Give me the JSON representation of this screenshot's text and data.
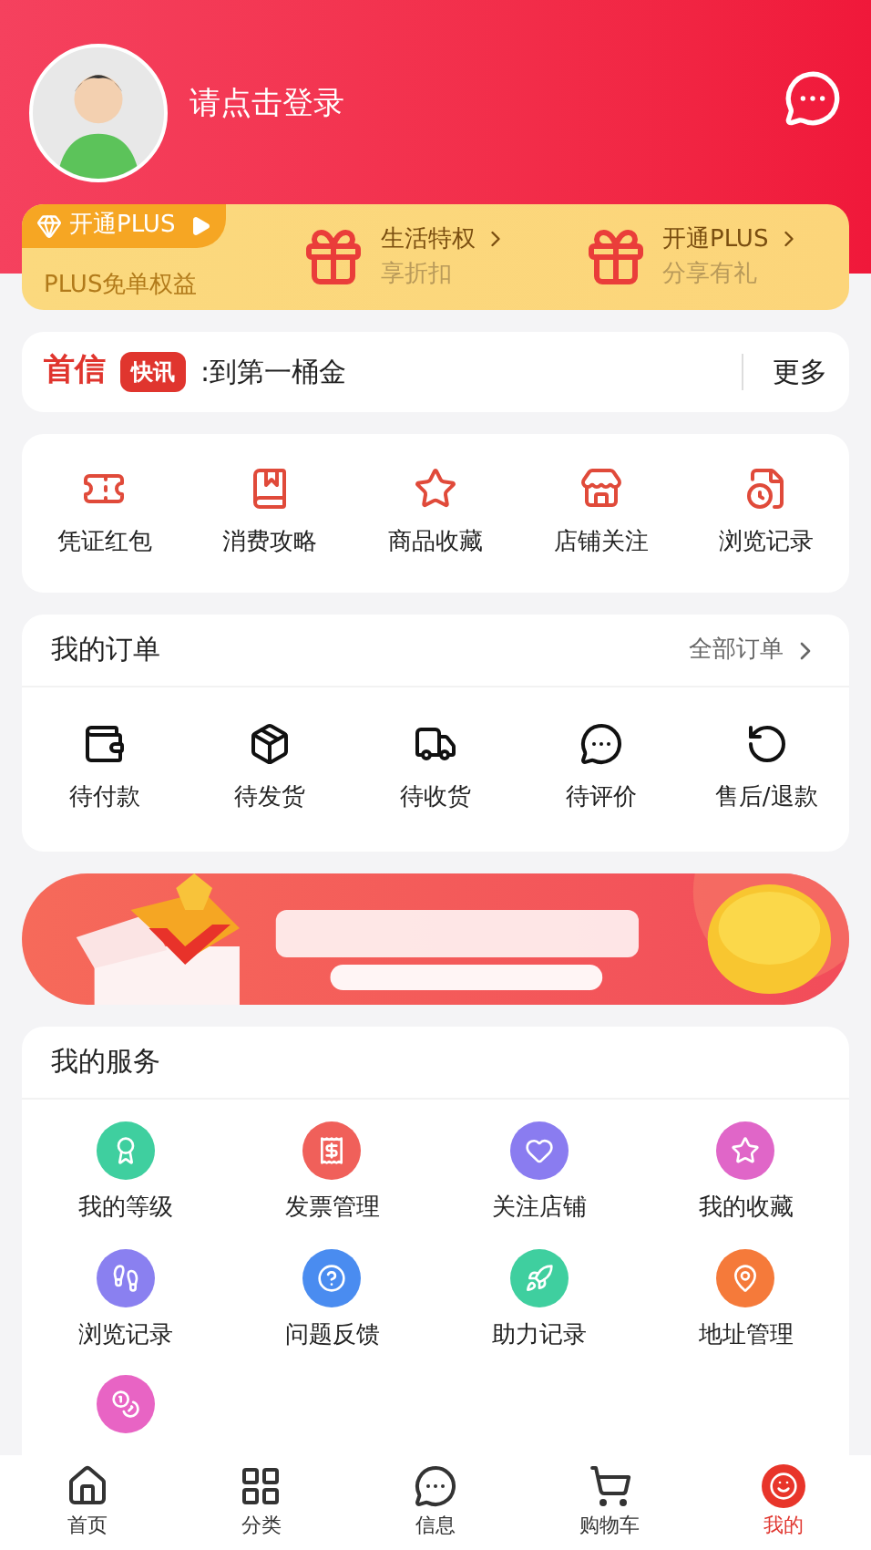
{
  "header": {
    "login_prompt": "请点击登录"
  },
  "plus_card": {
    "badge": "开通PLUS",
    "subtitle": "PLUS免单权益",
    "offers": [
      {
        "title": "生活特权",
        "subtitle": "享折扣"
      },
      {
        "title": "开通PLUS",
        "subtitle": "分享有礼"
      }
    ]
  },
  "news": {
    "brand": "首信",
    "tag": "快讯",
    "headline": ":到第一桶金",
    "more": "更多"
  },
  "shortcuts": [
    {
      "label": "凭证红包"
    },
    {
      "label": "消费攻略"
    },
    {
      "label": "商品收藏"
    },
    {
      "label": "店铺关注"
    },
    {
      "label": "浏览记录"
    }
  ],
  "orders": {
    "title": "我的订单",
    "all": "全部订单",
    "items": [
      {
        "label": "待付款"
      },
      {
        "label": "待发货"
      },
      {
        "label": "待收货"
      },
      {
        "label": "待评价"
      },
      {
        "label": "售后/退款"
      }
    ]
  },
  "services": {
    "title": "我的服务",
    "items": [
      {
        "label": "我的等级",
        "color": "#3fcf9f"
      },
      {
        "label": "发票管理",
        "color": "#f0605a"
      },
      {
        "label": "关注店铺",
        "color": "#8a7cf0"
      },
      {
        "label": "我的收藏",
        "color": "#e066c8"
      },
      {
        "label": "浏览记录",
        "color": "#8a80f0"
      },
      {
        "label": "问题反馈",
        "color": "#4a8cf0"
      },
      {
        "label": "助力记录",
        "color": "#3fcf9f"
      },
      {
        "label": "地址管理",
        "color": "#f57a3a"
      },
      {
        "color": "#e864c4"
      }
    ]
  },
  "tab_bar": [
    {
      "label": "首页",
      "selected": false
    },
    {
      "label": "分类",
      "selected": false
    },
    {
      "label": "信息",
      "selected": false
    },
    {
      "label": "购物车",
      "selected": false
    },
    {
      "label": "我的",
      "selected": true
    }
  ]
}
